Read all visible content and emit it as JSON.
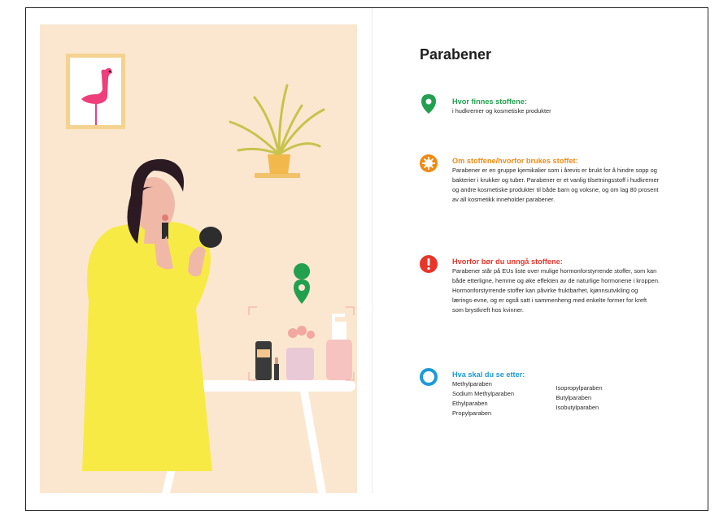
{
  "page": {
    "title": "Parabener"
  },
  "sections": [
    {
      "icon": "location-pin-icon",
      "heading": "Hvor finnes stoffene:",
      "text": "i hudkremer og kosmetiske produkter",
      "color": "#22a04f"
    },
    {
      "icon": "virus-icon",
      "heading": "Om stoffene/hvorfor brukes stoffet:",
      "text": "Parabener er en gruppe kjemikalier som i årevis er brukt for å hindre sopp og bakterier i krukker og tuber. Parabener er et vanlig tilsetningsstoff i hudkremer og andre kosmetiske produkter til både barn og voksne, og om lag 80 prosent av all kosmetikk inneholder parabener.",
      "color": "#ef8a12"
    },
    {
      "icon": "warning-icon",
      "heading": "Hvorfor bør du unngå stoffene:",
      "text": "Parabener står på EUs liste over mulige hormonforstyrrende stoffer, som kan både etterligne, hemme og øke effekten av de naturlige hormonene i kroppen. Hormonforstyrrende stoffer kan påvirke fruktbarhet, kjønnsutvikling og lærings-evne, og er også satt i sammenheng med enkelte former for kreft som brystkreft hos kvinner.",
      "color": "#e8352b"
    },
    {
      "icon": "ring-icon",
      "heading": "Hva skal du se etter:",
      "color": "#1b9ad6",
      "list_col1": [
        "Methylparaben",
        "Sodium Methylparaben",
        "Ethylparaben",
        "Propylparaben"
      ],
      "list_col2": [
        "Isopropylparaben",
        "Butylparaben",
        "Isobutylparaben"
      ]
    }
  ],
  "colors": {
    "background_panel": "#fbe7cf",
    "dress": "#f7ea45",
    "pin": "#22a04f"
  }
}
